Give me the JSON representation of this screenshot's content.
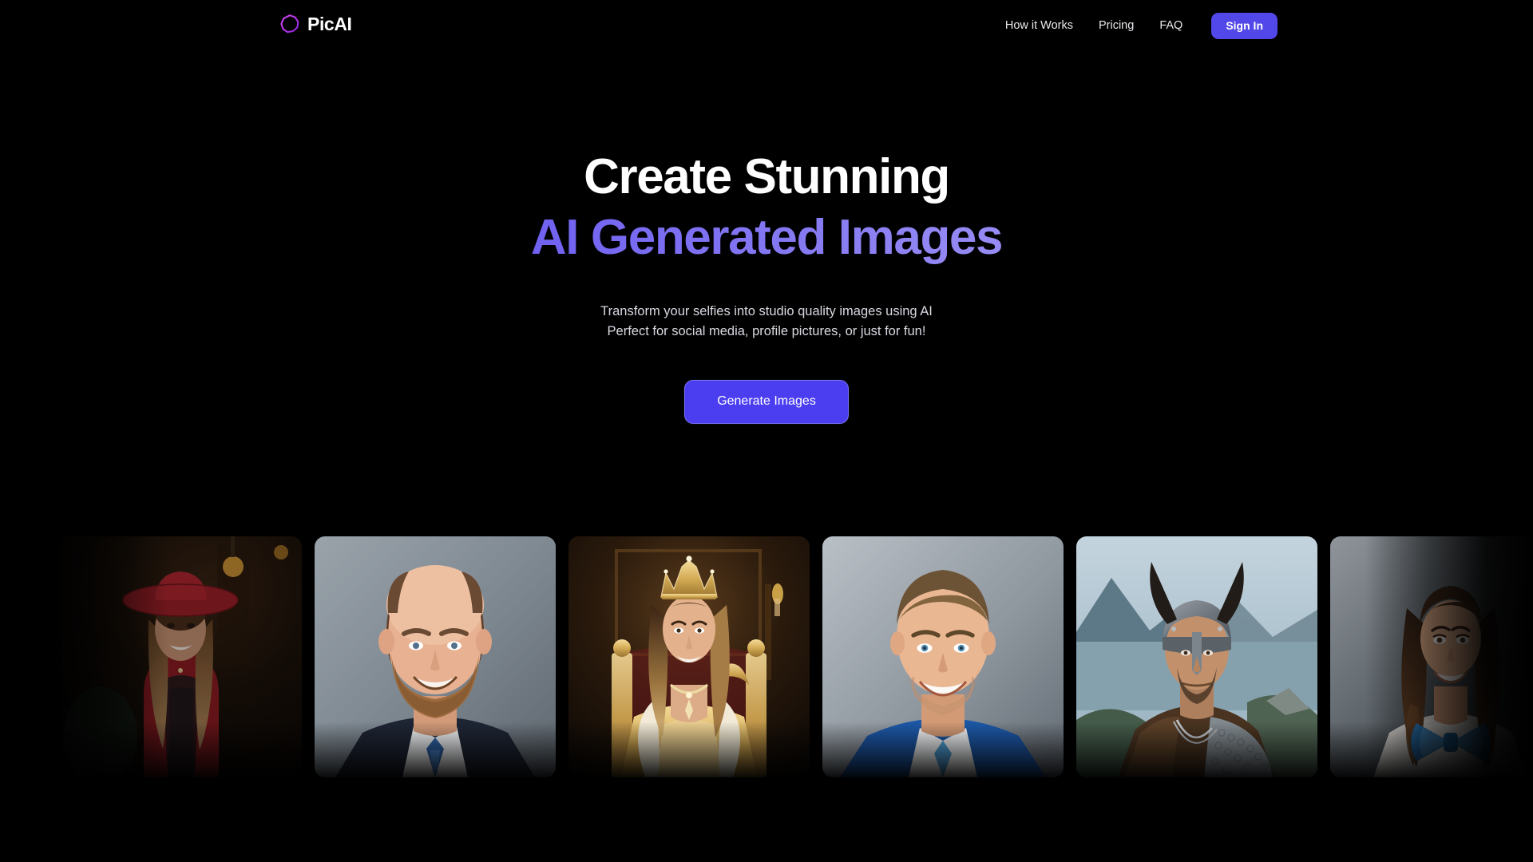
{
  "brand": {
    "name": "PicAI",
    "logo_icon": "octagon-outline-icon",
    "logo_color": "#c03cf0"
  },
  "nav": {
    "links": [
      {
        "label": "How it Works"
      },
      {
        "label": "Pricing"
      },
      {
        "label": "FAQ"
      }
    ],
    "signin_label": "Sign In",
    "signin_color": "#5247e8"
  },
  "hero": {
    "title_line1": "Create Stunning",
    "title_line2": "AI Generated Images",
    "gradient_from": "#4b40e6",
    "gradient_to": "#c3b6fb",
    "subtitle_line1": "Transform your selfies into studio quality images using AI",
    "subtitle_line2": "Perfect for social media, profile pictures, or just for fun!",
    "cta_label": "Generate Images",
    "cta_color": "#4a3ef0"
  },
  "gallery": {
    "items": [
      {
        "alt": "Woman in red hat and red blazer in a warm interior"
      },
      {
        "alt": "Smiling bearded man in navy suit with blue tie, studio portrait"
      },
      {
        "alt": "Woman wearing a jewelled crown and gold gown on a golden throne"
      },
      {
        "alt": "Smiling man in blue suit with light blue tie, studio portrait"
      },
      {
        "alt": "Viking warrior in horned helmet and chainmail by a fjord"
      },
      {
        "alt": "Smiling woman with long brown hair and a blue bow tie"
      }
    ]
  }
}
